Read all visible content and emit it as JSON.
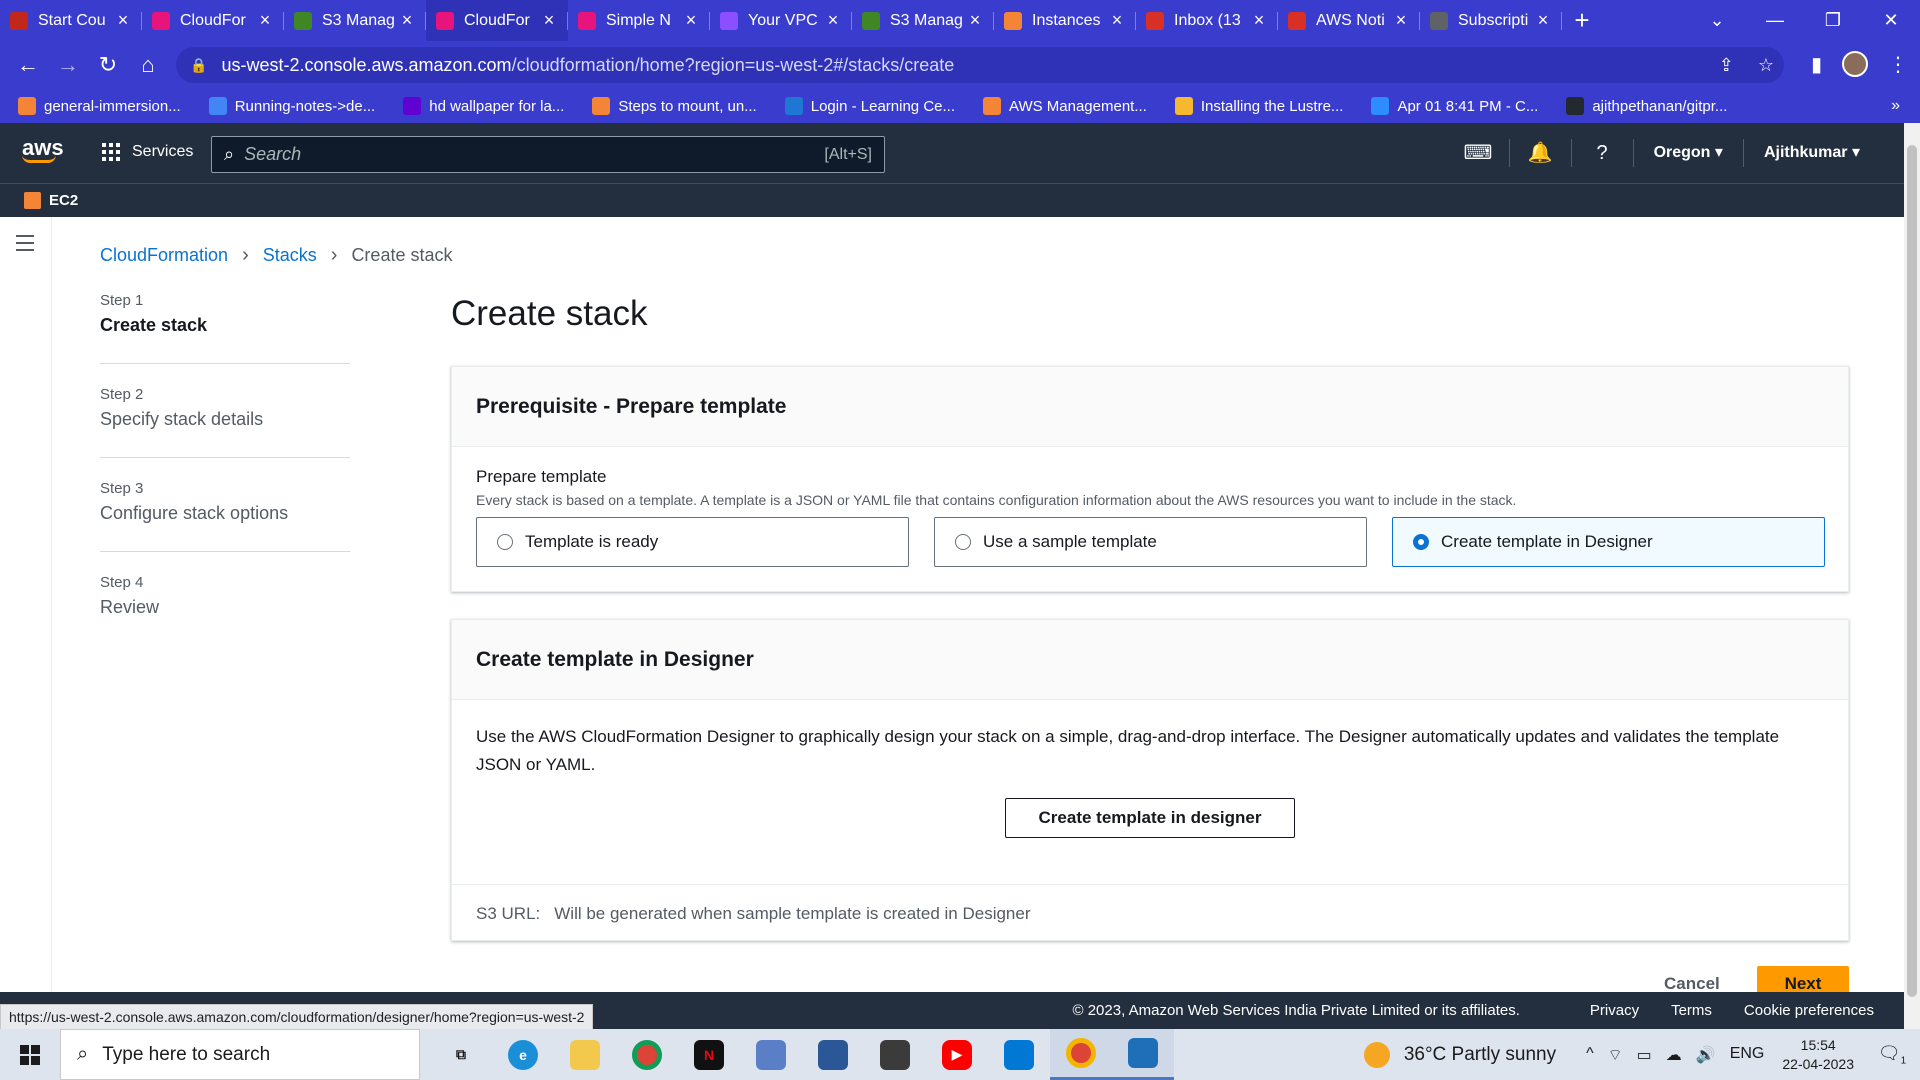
{
  "browser": {
    "tabs": [
      {
        "title": "Start Cou",
        "icon": "coursera-icon",
        "color": "#c3271b"
      },
      {
        "title": "CloudFor",
        "icon": "cloudformation-icon",
        "color": "#e7157b"
      },
      {
        "title": "S3 Manag",
        "icon": "s3-icon",
        "color": "#3f8624"
      },
      {
        "title": "CloudFor",
        "icon": "cloudformation-icon",
        "color": "#e7157b",
        "active": true
      },
      {
        "title": "Simple N",
        "icon": "sns-icon",
        "color": "#e7157b"
      },
      {
        "title": "Your VPC",
        "icon": "vpc-icon",
        "color": "#8c4fff"
      },
      {
        "title": "S3 Manag",
        "icon": "s3-icon",
        "color": "#3f8624"
      },
      {
        "title": "Instances",
        "icon": "ec2-icon",
        "color": "#f58536"
      },
      {
        "title": "Inbox (13",
        "icon": "gmail-icon",
        "color": "#d93025"
      },
      {
        "title": "AWS Noti",
        "icon": "gmail-icon",
        "color": "#d93025"
      },
      {
        "title": "Subscripti",
        "icon": "globe-icon",
        "color": "#5f6368"
      }
    ],
    "url_domain": "us-west-2.console.aws.amazon.com",
    "url_path": "/cloudformation/home?region=us-west-2#/stacks/create",
    "bookmarks": [
      {
        "label": "general-immersion...",
        "color": "#f58536"
      },
      {
        "label": "Running-notes->de...",
        "color": "#4285f4"
      },
      {
        "label": "hd wallpaper for la...",
        "color": "#6001d2"
      },
      {
        "label": "Steps to mount, un...",
        "color": "#f58536"
      },
      {
        "label": "Login - Learning Ce...",
        "color": "#1f77d4"
      },
      {
        "label": "AWS Management...",
        "color": "#f58536"
      },
      {
        "label": "Installing the Lustre...",
        "color": "#f5b82e"
      },
      {
        "label": "Apr 01 8:41 PM - C...",
        "color": "#2d8cff"
      },
      {
        "label": "ajithpethanan/gitpr...",
        "color": "#24292f"
      }
    ],
    "status_url": "https://us-west-2.console.aws.amazon.com/cloudformation/designer/home?region=us-west-2"
  },
  "aws": {
    "logo": "aws",
    "services_label": "Services",
    "search_placeholder": "Search",
    "search_shortcut": "[Alt+S]",
    "region": "Oregon",
    "user": "Ajithkumar",
    "favorite": "EC2"
  },
  "breadcrumb": {
    "items": [
      "CloudFormation",
      "Stacks"
    ],
    "current": "Create stack"
  },
  "steps": [
    {
      "num": "Step 1",
      "label": "Create stack",
      "current": true
    },
    {
      "num": "Step 2",
      "label": "Specify stack details"
    },
    {
      "num": "Step 3",
      "label": "Configure stack options"
    },
    {
      "num": "Step 4",
      "label": "Review"
    }
  ],
  "page_title": "Create stack",
  "prereq": {
    "heading": "Prerequisite - Prepare template",
    "field_label": "Prepare template",
    "field_desc": "Every stack is based on a template. A template is a JSON or YAML file that contains configuration information about the AWS resources you want to include in the stack.",
    "options": [
      {
        "label": "Template is ready",
        "selected": false
      },
      {
        "label": "Use a sample template",
        "selected": false
      },
      {
        "label": "Create template in Designer",
        "selected": true
      }
    ]
  },
  "designer": {
    "heading": "Create template in Designer",
    "description": "Use the AWS CloudFormation Designer to graphically design your stack on a simple, drag-and-drop interface. The Designer automatically updates and validates the template JSON or YAML.",
    "button": "Create template in designer",
    "s3_label": "S3 URL:",
    "s3_value": "Will be generated when sample template is created in Designer"
  },
  "actions": {
    "cancel": "Cancel",
    "next": "Next"
  },
  "footer": {
    "copyright": "© 2023, Amazon Web Services India Private Limited or its affiliates.",
    "links": [
      "Privacy",
      "Terms",
      "Cookie preferences"
    ]
  },
  "taskbar": {
    "search_placeholder": "Type here to search",
    "weather": "36°C  Partly sunny",
    "lang": "ENG",
    "time": "15:54",
    "date": "22-04-2023",
    "notification_count": "1"
  }
}
